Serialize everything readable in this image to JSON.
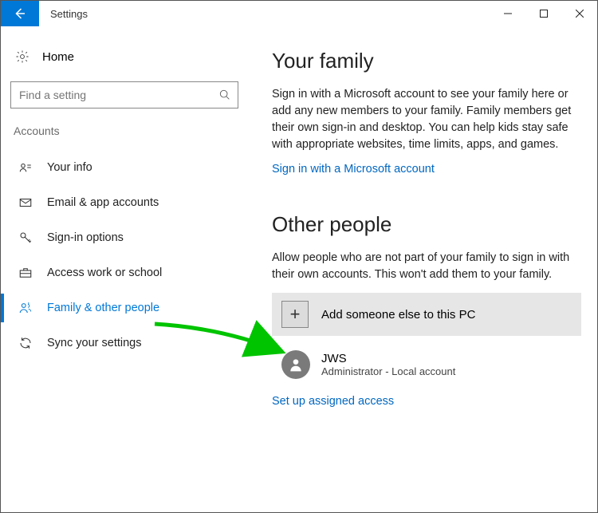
{
  "window": {
    "title": "Settings"
  },
  "sidebar": {
    "home_label": "Home",
    "search_placeholder": "Find a setting",
    "category": "Accounts",
    "items": [
      {
        "label": "Your info"
      },
      {
        "label": "Email & app accounts"
      },
      {
        "label": "Sign-in options"
      },
      {
        "label": "Access work or school"
      },
      {
        "label": "Family & other people"
      },
      {
        "label": "Sync your settings"
      }
    ]
  },
  "content": {
    "family": {
      "heading": "Your family",
      "desc": "Sign in with a Microsoft account to see your family here or add any new members to your family. Family members get their own sign-in and desktop. You can help kids stay safe with appropriate websites, time limits, apps, and games.",
      "link": "Sign in with a Microsoft account"
    },
    "other": {
      "heading": "Other people",
      "desc": "Allow people who are not part of your family to sign in with their own accounts. This won't add them to your family.",
      "add_label": "Add someone else to this PC",
      "user": {
        "name": "JWS",
        "role": "Administrator - Local account"
      },
      "assigned_link": "Set up assigned access"
    }
  }
}
